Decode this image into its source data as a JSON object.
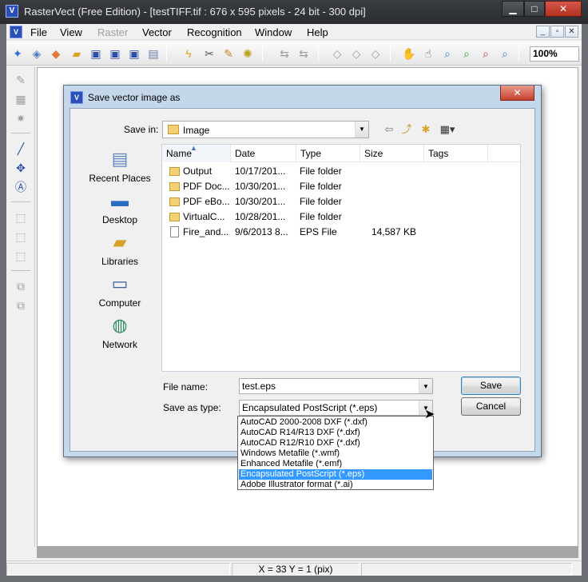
{
  "window": {
    "title": "RasterVect (Free Edition) - [testTIFF.tif : 676 x 595 pixels - 24 bit - 300 dpi]",
    "min_glyph": "▁",
    "max_glyph": "□",
    "close_glyph": "✕"
  },
  "menu": {
    "items": [
      "File",
      "View",
      "Raster",
      "Vector",
      "Recognition",
      "Window",
      "Help"
    ],
    "mdi_min": "_",
    "mdi_restore": "▫",
    "mdi_close": "✕"
  },
  "toolbar": {
    "zoom": "100%"
  },
  "dialog": {
    "title": "Save vector image as",
    "close_glyph": "✕",
    "save_in_label": "Save in:",
    "save_in_value": "Image",
    "places": [
      "Recent Places",
      "Desktop",
      "Libraries",
      "Computer",
      "Network"
    ],
    "columns": [
      "Name",
      "Date",
      "Type",
      "Size",
      "Tags"
    ],
    "files": [
      {
        "name": "Output",
        "date": "10/17/201...",
        "type": "File folder",
        "size": "",
        "kind": "folder"
      },
      {
        "name": "PDF Doc...",
        "date": "10/30/201...",
        "type": "File folder",
        "size": "",
        "kind": "folder"
      },
      {
        "name": "PDF eBo...",
        "date": "10/30/201...",
        "type": "File folder",
        "size": "",
        "kind": "folder"
      },
      {
        "name": "VirtualC...",
        "date": "10/28/201...",
        "type": "File folder",
        "size": "",
        "kind": "folder"
      },
      {
        "name": "Fire_and...",
        "date": "9/6/2013 8...",
        "type": "EPS File",
        "size": "14,587 KB",
        "kind": "file"
      }
    ],
    "file_name_label": "File name:",
    "file_name_value": "test.eps",
    "save_as_type_label": "Save as type:",
    "save_as_type_value": "Encapsulated PostScript (*.eps)",
    "save_button": "Save",
    "cancel_button": "Cancel",
    "type_options": [
      "AutoCAD 2000-2008 DXF (*.dxf)",
      "AutoCAD R14/R13 DXF (*.dxf)",
      "AutoCAD R12/R10 DXF (*.dxf)",
      "Windows Metafile (*.wmf)",
      "Enhanced Metafile (*.emf)",
      "Encapsulated PostScript (*.eps)",
      "Adobe Illustrator format (*.ai)"
    ],
    "selected_type_index": 5
  },
  "status": {
    "coords": "X = 33   Y = 1 (pix)"
  }
}
